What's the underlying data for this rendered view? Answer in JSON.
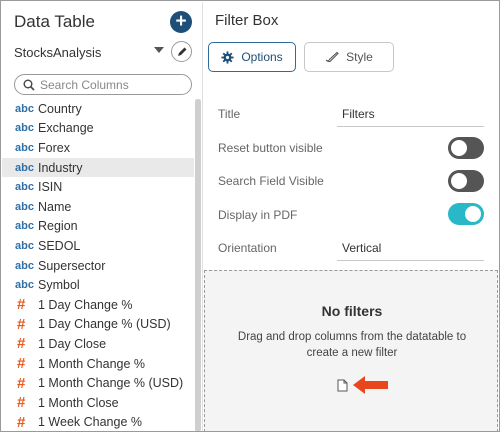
{
  "left_panel": {
    "title": "Data Table",
    "data_source": "StocksAnalysis",
    "search_placeholder": "Search Columns",
    "columns": [
      {
        "type": "abc",
        "name": "Country"
      },
      {
        "type": "abc",
        "name": "Exchange"
      },
      {
        "type": "abc",
        "name": "Forex"
      },
      {
        "type": "abc",
        "name": "Industry"
      },
      {
        "type": "abc",
        "name": "ISIN"
      },
      {
        "type": "abc",
        "name": "Name"
      },
      {
        "type": "abc",
        "name": "Region"
      },
      {
        "type": "abc",
        "name": "SEDOL"
      },
      {
        "type": "abc",
        "name": "Supersector"
      },
      {
        "type": "abc",
        "name": "Symbol"
      },
      {
        "type": "#",
        "name": "1 Day Change %"
      },
      {
        "type": "#",
        "name": "1 Day Change % (USD)"
      },
      {
        "type": "#",
        "name": "1 Day Close"
      },
      {
        "type": "#",
        "name": "1 Month Change %"
      },
      {
        "type": "#",
        "name": "1 Month Change % (USD)"
      },
      {
        "type": "#",
        "name": "1 Month Close"
      },
      {
        "type": "#",
        "name": "1 Week Change %"
      }
    ],
    "selected_column": "Industry"
  },
  "right_panel": {
    "title": "Filter Box",
    "options_label": "Options",
    "style_label": "Style",
    "properties": {
      "title_label": "Title",
      "title_value": "Filters",
      "reset_label": "Reset button visible",
      "reset_on": false,
      "search_label": "Search Field Visible",
      "search_on": false,
      "pdf_label": "Display in PDF",
      "pdf_on": true,
      "orientation_label": "Orientation",
      "orientation_value": "Vertical"
    },
    "drop_zone": {
      "title": "No filters",
      "text": "Drag and drop columns from the datatable to create a new filter"
    }
  },
  "colors": {
    "accent": "#1e4f78",
    "toggle_on": "#29b8c8",
    "numeric_type": "#e85a1f",
    "text_type": "#2f6fa8",
    "arrow": "#e8471e"
  }
}
